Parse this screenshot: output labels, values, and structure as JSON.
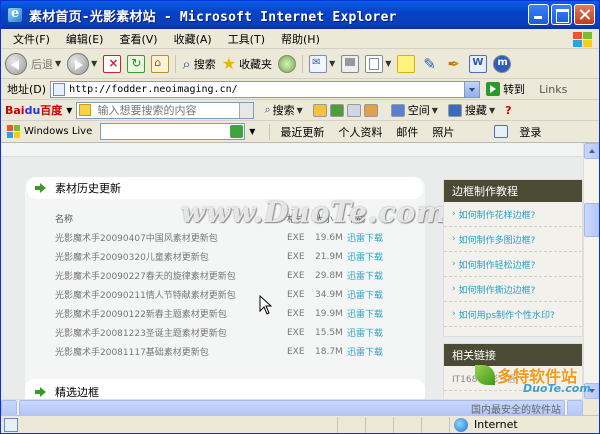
{
  "window": {
    "title": "素材首页-光影素材站 - Microsoft Internet Explorer"
  },
  "menubar": {
    "items": [
      "文件(F)",
      "编辑(E)",
      "查看(V)",
      "收藏(A)",
      "工具(T)",
      "帮助(H)"
    ]
  },
  "toolbar": {
    "back_label": "后退",
    "search_label": "搜索",
    "favorites_label": "收藏夹"
  },
  "address": {
    "label": "地址(D)",
    "url": "http://fodder.neoimaging.cn/",
    "go_label": "转到",
    "links_label": "Links"
  },
  "baidu": {
    "logo_a": "Bai",
    "logo_b": "du",
    "logo_c": "百度",
    "placeholder": "输入想要搜索的内容",
    "search_label": "搜索",
    "space_label": "空间",
    "collect_label": "搜藏"
  },
  "live": {
    "logo": "Windows Live",
    "links": [
      "最近更新",
      "个人资料",
      "邮件",
      "照片"
    ],
    "login": "登录"
  },
  "content": {
    "section_title": "素材历史更新",
    "columns": [
      "名称",
      "格式",
      "大小",
      "下载"
    ],
    "rows": [
      {
        "name": "光影魔术手20090407中国风素材更新包",
        "format": "EXE",
        "size": "19.6M",
        "dl": "迅雷下载"
      },
      {
        "name": "光影魔术手20090320儿童素材更新包",
        "format": "EXE",
        "size": "21.9M",
        "dl": "迅雷下载"
      },
      {
        "name": "光影魔术手20090227春天的旋律素材更新包",
        "format": "EXE",
        "size": "29.8M",
        "dl": "迅雷下载"
      },
      {
        "name": "光影魔术手20090211情人节特献素材更新包",
        "format": "EXE",
        "size": "34.9M",
        "dl": "迅雷下载"
      },
      {
        "name": "光影魔术手20090122新春主题素材更新包",
        "format": "EXE",
        "size": "19.9M",
        "dl": "迅雷下载"
      },
      {
        "name": "光影魔术手20081223圣诞主题素材更新包",
        "format": "EXE",
        "size": "15.5M",
        "dl": "迅雷下载"
      },
      {
        "name": "光影魔术手20081117基础素材更新包",
        "format": "EXE",
        "size": "18.7M",
        "dl": "迅雷下载"
      }
    ],
    "watermark": "www.DuoTe.com",
    "next_section": "精选边框"
  },
  "sidebar": {
    "title": "边框制作教程",
    "items": [
      "如何制作花样边框?",
      "如何制作多图边框?",
      "如何制作轻松边框?",
      "如何制作撕边边框?",
      "如何用ps制作个性水印?"
    ],
    "links_title": "相关链接",
    "links_item": "IT168 光影专区"
  },
  "status": {
    "zone": "Internet"
  },
  "corner_watermark": {
    "line1": "多特软件站",
    "line2": "DuoTe.com",
    "line3": "国内最安全的软件站"
  }
}
